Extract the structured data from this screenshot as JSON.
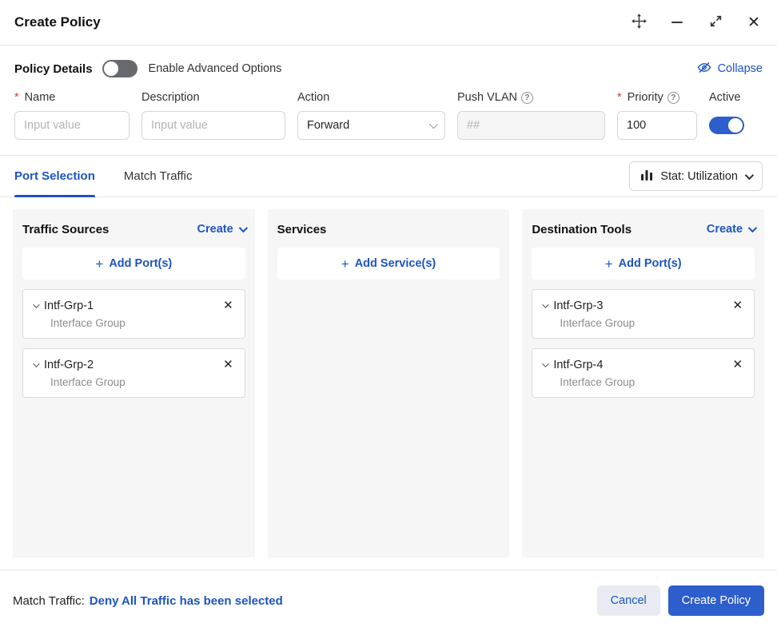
{
  "colors": {
    "accent": "#1d54c2",
    "primary_button": "#2e5ecc"
  },
  "icons": {
    "close": "✕",
    "plus": "+",
    "asterisk": "*",
    "question": "?"
  },
  "header": {
    "title": "Create Policy"
  },
  "policy_details": {
    "section_label": "Policy Details",
    "advanced_toggle_label": "Enable Advanced Options",
    "advanced_toggle_state": "off",
    "collapse_label": "Collapse",
    "fields": {
      "name": {
        "label": "Name",
        "required": true,
        "placeholder": "Input value",
        "value": ""
      },
      "description": {
        "label": "Description",
        "placeholder": "Input value",
        "value": ""
      },
      "action": {
        "label": "Action",
        "value": "Forward"
      },
      "push_vlan": {
        "label": "Push VLAN",
        "placeholder": "##",
        "value": "",
        "disabled": true
      },
      "priority": {
        "label": "Priority",
        "required": true,
        "value": "100"
      },
      "active": {
        "label": "Active",
        "state": "on"
      }
    }
  },
  "tabs": [
    {
      "label": "Port Selection",
      "active": true
    },
    {
      "label": "Match Traffic",
      "active": false
    }
  ],
  "stat_selector": {
    "label": "Stat: Utilization"
  },
  "columns": [
    {
      "title": "Traffic Sources",
      "create_label": "Create",
      "add_button_label": "Add Port(s)",
      "items": [
        {
          "name": "Intf-Grp-1",
          "subtitle": "Interface Group"
        },
        {
          "name": "Intf-Grp-2",
          "subtitle": "Interface Group"
        }
      ]
    },
    {
      "title": "Services",
      "add_button_label": "Add Service(s)",
      "items": []
    },
    {
      "title": "Destination Tools",
      "create_label": "Create",
      "add_button_label": "Add Port(s)",
      "items": [
        {
          "name": "Intf-Grp-3",
          "subtitle": "Interface Group"
        },
        {
          "name": "Intf-Grp-4",
          "subtitle": "Interface Group"
        }
      ]
    }
  ],
  "footer": {
    "match_label": "Match Traffic:",
    "match_value": "Deny All Traffic has been selected",
    "cancel_label": "Cancel",
    "submit_label": "Create Policy"
  }
}
